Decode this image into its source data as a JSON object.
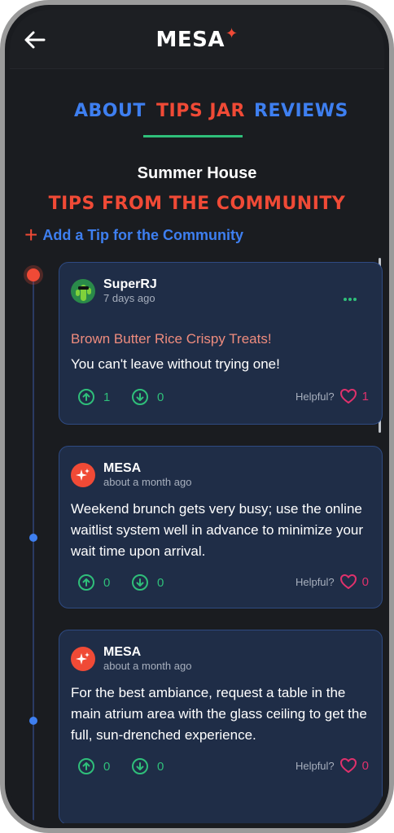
{
  "app": {
    "brand": "MESA",
    "brand_spark": "✦"
  },
  "tabs": [
    {
      "label": "ABOUT"
    },
    {
      "label": "TIPS JAR"
    },
    {
      "label": "REVIEWS"
    }
  ],
  "venue_name": "Summer House",
  "section_title": "TIPS FROM THE COMMUNITY",
  "add_tip_label": "Add a Tip for the Community",
  "helpful_label": "Helpful?",
  "colors": {
    "accent_red": "#f04a36",
    "accent_blue": "#3e7ff0",
    "accent_green": "#2fbf7a",
    "heart_pink": "#e0316c",
    "card_bg": "#1f2d47"
  },
  "tips": [
    {
      "author": "SuperRJ",
      "time": "7 days ago",
      "title": "Brown Butter Rice Crispy Treats!",
      "body": "You can't leave without trying one!",
      "upvotes": "1",
      "downvotes": "0",
      "helpful_count": "1",
      "avatar_icon": "cactus-sunglasses-icon"
    },
    {
      "author": "MESA",
      "time": "about a month ago",
      "body": "Weekend brunch gets very busy; use the online waitlist system well in advance to minimize your wait time upon arrival.",
      "upvotes": "0",
      "downvotes": "0",
      "helpful_count": "0",
      "avatar_icon": "sparkle-icon"
    },
    {
      "author": "MESA",
      "time": "about a month ago",
      "body": "For the best ambiance, request a table in the main atrium area with the glass ceiling to get the full, sun-drenched experience.",
      "upvotes": "0",
      "downvotes": "0",
      "helpful_count": "0",
      "avatar_icon": "sparkle-icon"
    }
  ]
}
